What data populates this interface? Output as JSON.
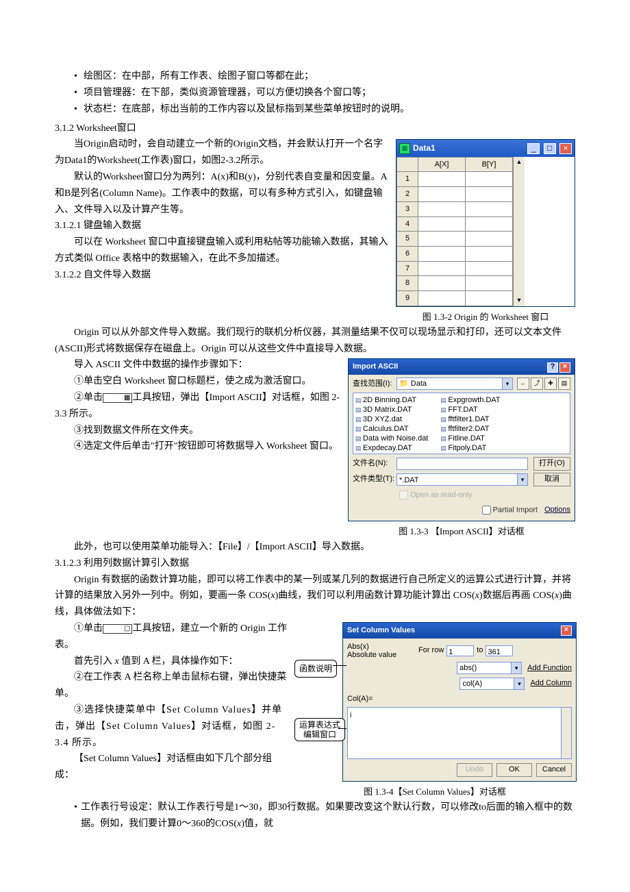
{
  "bullets_top": [
    "绘图区：在中部，所有工作表、绘图子窗口等都在此；",
    "项目管理器：在下部，类似资源管理器，可以方便切换各个窗口等；",
    "状态栏：在底部，标出当前的工作内容以及鼠标指到某些菜单按钮时的说明。"
  ],
  "h312": "3.1.2 Worksheet窗口",
  "p312a": "当Origin启动时，会自动建立一个新的Origin文档，并会默认打开一个名字为Data1的Worksheet(工作表)窗口，如图2-3.2所示。",
  "p312b": "默认的Worksheet窗口分为两列：A(x)和B(y)，分别代表自变量和因变量。A和B是列名(Column Name)。工作表中的数据，可以有多种方式引入，如键盘输入、文件导入以及计算产生等。",
  "h3121": "3.1.2.1 键盘输入数据",
  "p3121": "可以在 Worksheet 窗口中直接键盘输入或利用粘帖等功能输入数据，其输入方式类似 Office 表格中的数据输入，在此不多加描述。",
  "h3122": "3.1.2.2 自文件导入数据",
  "p3122a": "Origin 可以从外部文件导入数据。我们现行的联机分析仪器，其测量结果不仅可以现场显示和打印，还可以文本文件(ASCII)形式将数据保存在磁盘上。Origin 可以从这些文件中直接导入数据。",
  "p3122b": "导入 ASCII 文件中数据的操作步骤如下：",
  "step1": "①单击空白 Worksheet 窗口标题栏，使之成为激活窗口。",
  "step2a": "②单击",
  "step2b": "工具按钮，弹出【Import ASCII】对话框，如图 2-3.3 所示。",
  "step3": "③找到数据文件所在文件夹。",
  "step4": "④选定文件后单击\"打开\"按钮即可将数据导入 Worksheet 窗口。",
  "p3122c": "此外，也可以使用菜单功能导入：【File】/【Import ASCII】导入数据。",
  "h3123": "3.1.2.3 利用列数据计算引入数据",
  "p3123a_1": "Origin 有数据的函数计算功能，即可以将工作表中的某一列或某几列的数据进行自己所定义的运算公式进行计算，并将计算的结果放入另外一列中。例如，要画一条 COS(",
  "p3123a_x1": "x",
  "p3123a_2": ")曲线，我们可以利用函数计算功能计算出 COS(",
  "p3123a_x2": "x",
  "p3123a_3": ")数据后再画 COS(",
  "p3123a_x3": "x",
  "p3123a_4": ")曲线，具体做法如下：",
  "step_c1a": "①单击",
  "step_c1b": "工具按钮，建立一个新的 Origin 工作表。",
  "step_c_intro_a": "首先引入 ",
  "step_c_intro_x": "x",
  "step_c_intro_b": " 值到 A 栏，具体操作如下：",
  "step_c2": "②在工作表 A 栏名称上单击鼠标右键，弹出快捷菜单。",
  "step_c3": "③选择快捷菜单中【Set Column Values】并单击，弹出【Set Column Values】对话框，如图 2-3.4 所示。",
  "p_scv": "【Set Column Values】对话框由如下几个部分组成：",
  "bullet_bottom_a": "工作表行号设定：默认工作表行号是1～30，即30行数据。如果要改变这个默认行数，可以修改to后面的输入框中的数据。例如，我们要计算0～360的COS(",
  "bullet_bottom_x": "x",
  "bullet_bottom_b": ")值，就",
  "fig132_caption": "图 1.3-2 Origin 的 Worksheet 窗口",
  "fig133_caption": "图 1.3-3 【Import ASCII】对话框",
  "fig134_caption": "图 1.3-4【Set Column Values】对话框",
  "worksheet": {
    "title": "Data1",
    "colA": "A[X]",
    "colB": "B[Y]",
    "rows": [
      "1",
      "2",
      "3",
      "4",
      "5",
      "6",
      "7",
      "8",
      "9"
    ]
  },
  "import_dlg": {
    "title": "Import ASCII",
    "look_lbl": "查找范围(I):",
    "look_val": "Data",
    "files_left": [
      "2D Binning.DAT",
      "3D Matrix.DAT",
      "3D XYZ.dat",
      "Calculus.DAT",
      "Data with Noise.dat",
      "Expdecay.DAT"
    ],
    "files_right": [
      "Expgrowth.DAT",
      "FFT.DAT",
      "fftfilter1.DAT",
      "fftfilter2.DAT",
      "Fitline.DAT",
      "Fitpoly.DAT"
    ],
    "fname_lbl": "文件名(N):",
    "ftype_lbl": "文件类型(T):",
    "ftype_val": "*.DAT",
    "readonly": "Open as read-only",
    "open_btn": "打开(O)",
    "cancel_btn": "取消",
    "partial": "Partial Import",
    "options": "Options"
  },
  "scv_dlg": {
    "title": "Set Column Values",
    "func1": "Abs(x)",
    "func2": "Absolute value",
    "for": "For row",
    "from": "1",
    "to_lbl": "to",
    "to": "361",
    "cmb1": "abs()",
    "add_func": "Add Function",
    "cmb2": "col(A)",
    "add_col": "Add Column",
    "col_eq": "Col(A)=",
    "expr": "i",
    "undo": "Undo",
    "ok": "OK",
    "cancel": "Cancel"
  },
  "callout1": "函数说明",
  "callout2": "运算表达式编辑窗口",
  "icon_import": "▦",
  "icon_new": "▢"
}
